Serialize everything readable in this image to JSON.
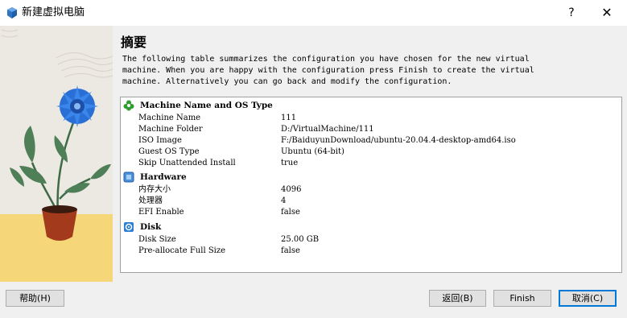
{
  "window": {
    "title": "新建虚拟电脑",
    "help_label": "?",
    "close_label": "✕"
  },
  "page": {
    "heading": "摘要",
    "description": [
      "The following table summarizes the configuration you have chosen for the new virtual",
      "machine. When you are happy with the configuration press Finish to create the virtual",
      "machine. Alternatively you can go back and modify the configuration."
    ]
  },
  "sections": [
    {
      "icon": "os-type-icon",
      "title": "Machine Name and OS Type",
      "rows": [
        {
          "key": "Machine Name",
          "value": "111"
        },
        {
          "key": "Machine Folder",
          "value": "D:/VirtualMachine/111"
        },
        {
          "key": "ISO Image",
          "value": "F:/BaiduyunDownload/ubuntu-20.04.4-desktop-amd64.iso"
        },
        {
          "key": "Guest OS Type",
          "value": "Ubuntu (64-bit)"
        },
        {
          "key": "Skip Unattended Install",
          "value": "true"
        }
      ]
    },
    {
      "icon": "hardware-chip-icon",
      "title": "Hardware",
      "rows": [
        {
          "key": "内存大小",
          "value": "4096"
        },
        {
          "key": "处理器",
          "value": "4"
        },
        {
          "key": "EFI Enable",
          "value": "false"
        }
      ]
    },
    {
      "icon": "disk-icon",
      "title": "Disk",
      "rows": [
        {
          "key": "Disk Size",
          "value": "25.00 GB"
        },
        {
          "key": "Pre-allocate Full Size",
          "value": "false"
        }
      ]
    }
  ],
  "buttons": {
    "help": "帮助(H)",
    "back": "返回(B)",
    "finish": "Finish",
    "cancel": "取消(C)"
  },
  "colors": {
    "accent": "#0078d7",
    "os_icon": "#2e9e2e",
    "hardware_icon": "#4a8fd8",
    "disk_icon": "#2a7fd4"
  }
}
